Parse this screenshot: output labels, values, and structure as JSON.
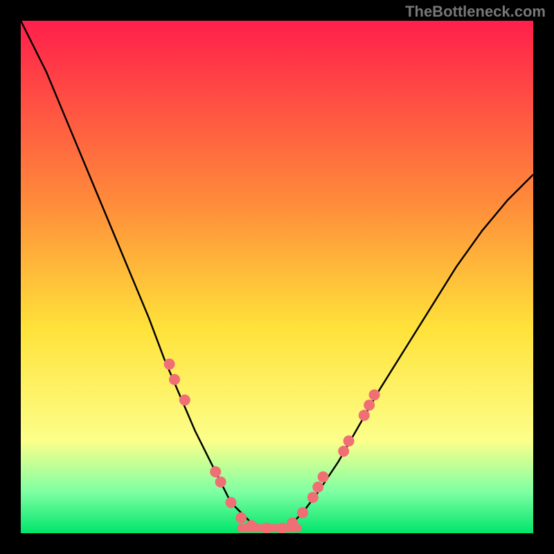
{
  "watermark": "TheBottleneck.com",
  "chart_data": {
    "type": "line",
    "title": "",
    "xlabel": "",
    "ylabel": "",
    "xlim": [
      0,
      100
    ],
    "ylim": [
      0,
      100
    ],
    "legend": false,
    "grid": false,
    "background_gradient_stops": [
      {
        "offset": 0.0,
        "color": "#ff1f4b"
      },
      {
        "offset": 0.35,
        "color": "#ff8a3a"
      },
      {
        "offset": 0.6,
        "color": "#ffe23a"
      },
      {
        "offset": 0.82,
        "color": "#fcff8a"
      },
      {
        "offset": 0.92,
        "color": "#7dffa3"
      },
      {
        "offset": 1.0,
        "color": "#00e56a"
      }
    ],
    "series": [
      {
        "name": "bottleneck-curve",
        "color": "#000000",
        "x": [
          0,
          5,
          10,
          15,
          20,
          25,
          28,
          31,
          34,
          37,
          39,
          41,
          43,
          45,
          48,
          51,
          53,
          55,
          58,
          62,
          66,
          70,
          75,
          80,
          85,
          90,
          95,
          100
        ],
        "values": [
          100,
          90,
          78,
          66,
          54,
          42,
          34,
          27,
          20,
          14,
          10,
          6,
          4,
          2,
          1,
          1,
          2,
          4,
          8,
          14,
          21,
          28,
          36,
          44,
          52,
          59,
          65,
          70
        ]
      }
    ],
    "markers": {
      "name": "highlight-points",
      "color": "#ef6f75",
      "radius": 8,
      "points": [
        {
          "x": 29,
          "y": 33
        },
        {
          "x": 30,
          "y": 30
        },
        {
          "x": 32,
          "y": 26
        },
        {
          "x": 38,
          "y": 12
        },
        {
          "x": 39,
          "y": 10
        },
        {
          "x": 41,
          "y": 6
        },
        {
          "x": 43,
          "y": 3
        },
        {
          "x": 45,
          "y": 1.5
        },
        {
          "x": 48,
          "y": 1
        },
        {
          "x": 51,
          "y": 1
        },
        {
          "x": 53,
          "y": 2
        },
        {
          "x": 55,
          "y": 4
        },
        {
          "x": 57,
          "y": 7
        },
        {
          "x": 58,
          "y": 9
        },
        {
          "x": 59,
          "y": 11
        },
        {
          "x": 63,
          "y": 16
        },
        {
          "x": 64,
          "y": 18
        },
        {
          "x": 67,
          "y": 23
        },
        {
          "x": 68,
          "y": 25
        },
        {
          "x": 69,
          "y": 27
        }
      ]
    },
    "flat_segment": {
      "name": "baseline-bar",
      "color": "#ef6f75",
      "thickness": 12,
      "y": 1,
      "x_start": 43,
      "x_end": 54
    }
  }
}
